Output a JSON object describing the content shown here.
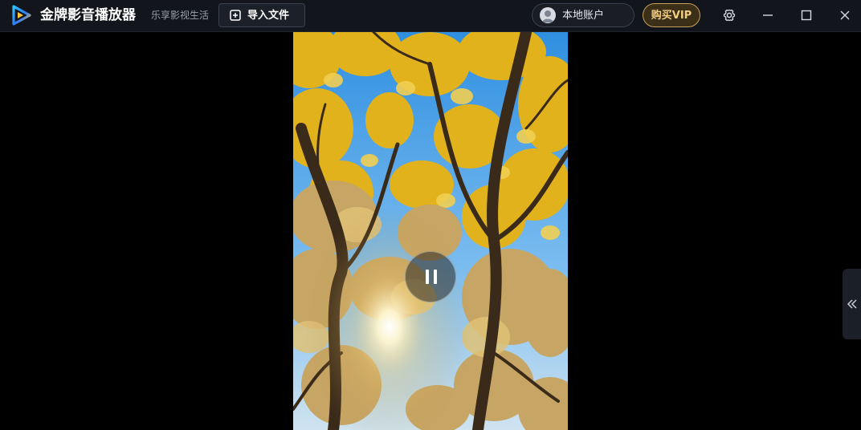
{
  "app": {
    "title": "金牌影音播放器",
    "slogan": "乐享影视生活"
  },
  "toolbar": {
    "import_label": "导入文件",
    "account_label": "本地账户",
    "vip_label": "购买VIP"
  },
  "window_controls": [
    "settings-icon",
    "minimize-icon",
    "maximize-icon",
    "close-icon"
  ],
  "player": {
    "state": "playing",
    "center_button_icon": "pause-icon",
    "side_panel_icon": "double-chevron-left-icon"
  },
  "colors": {
    "titlebar_bg": "#12151b",
    "video_bg": "#000000",
    "vip_gold": "#f2cd82",
    "accent_blue": "#2e7cf6"
  }
}
